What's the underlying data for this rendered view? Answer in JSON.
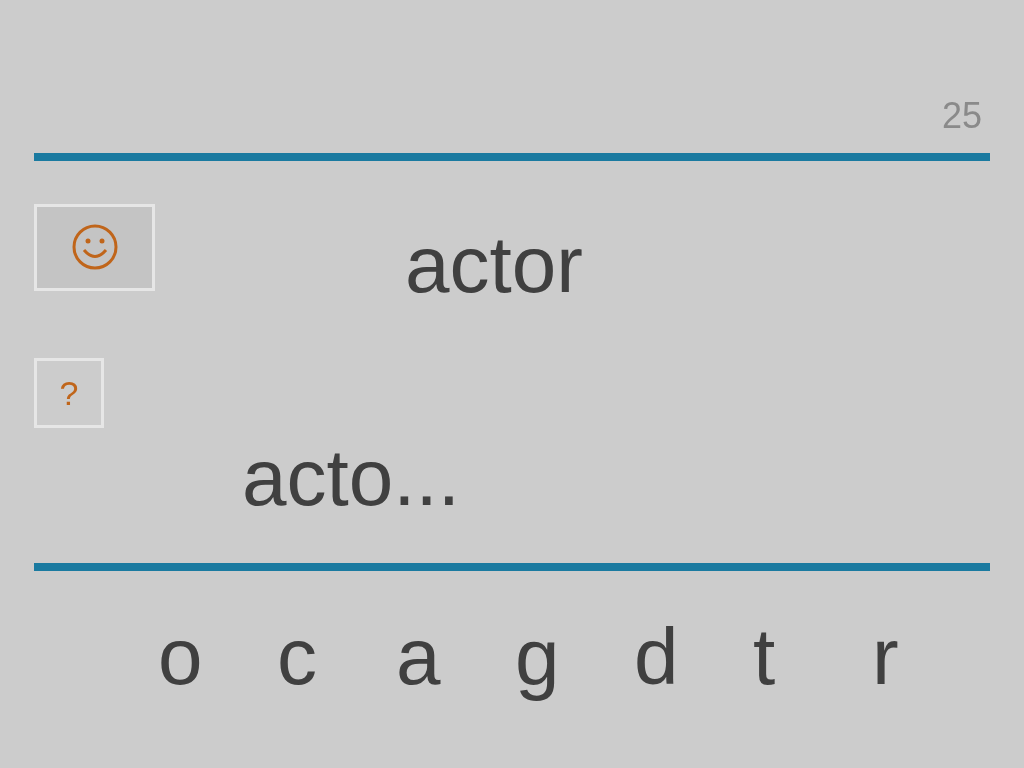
{
  "counter": "25",
  "word": "actor",
  "buttons": [
    {
      "kind": "smiley"
    },
    {
      "kind": "hint",
      "label": "?"
    }
  ],
  "answer": "acto...",
  "letters": [
    "o",
    "c",
    "a",
    "g",
    "d",
    "t",
    "r"
  ]
}
